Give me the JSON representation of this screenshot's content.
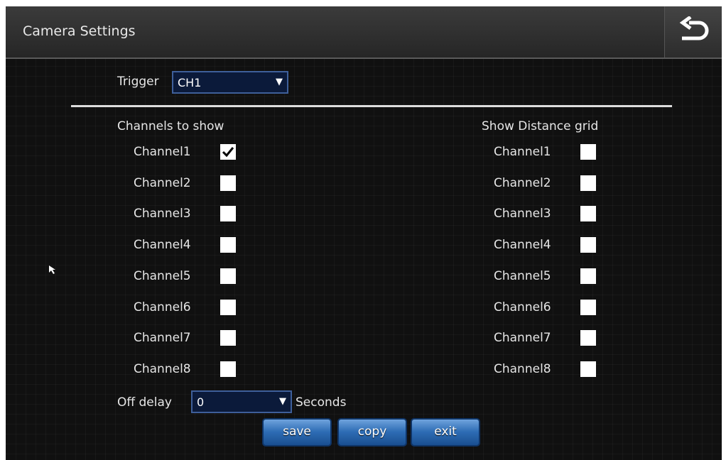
{
  "header": {
    "title": "Camera Settings",
    "back_icon": "back-arrow-icon"
  },
  "trigger": {
    "label": "Trigger",
    "value": "CH1"
  },
  "channels_to_show": {
    "heading": "Channels to show",
    "items": [
      {
        "label": "Channel1",
        "checked": true
      },
      {
        "label": "Channel2",
        "checked": false
      },
      {
        "label": "Channel3",
        "checked": false
      },
      {
        "label": "Channel4",
        "checked": false
      },
      {
        "label": "Channel5",
        "checked": false
      },
      {
        "label": "Channel6",
        "checked": false
      },
      {
        "label": "Channel7",
        "checked": false
      },
      {
        "label": "Channel8",
        "checked": false
      }
    ]
  },
  "distance_grid": {
    "heading": "Show Distance grid",
    "items": [
      {
        "label": "Channel1",
        "checked": false
      },
      {
        "label": "Channel2",
        "checked": false
      },
      {
        "label": "Channel3",
        "checked": false
      },
      {
        "label": "Channel4",
        "checked": false
      },
      {
        "label": "Channel5",
        "checked": false
      },
      {
        "label": "Channel6",
        "checked": false
      },
      {
        "label": "Channel7",
        "checked": false
      },
      {
        "label": "Channel8",
        "checked": false
      }
    ]
  },
  "off_delay": {
    "label": "Off delay",
    "value": "0",
    "unit": "Seconds"
  },
  "buttons": {
    "save": "save",
    "copy": "copy",
    "exit": "exit"
  },
  "colors": {
    "background": "#101010",
    "dropdown_fill": "#0b1a3a",
    "dropdown_border": "#3e5f9a",
    "button_blue": "#2d6cb4"
  }
}
